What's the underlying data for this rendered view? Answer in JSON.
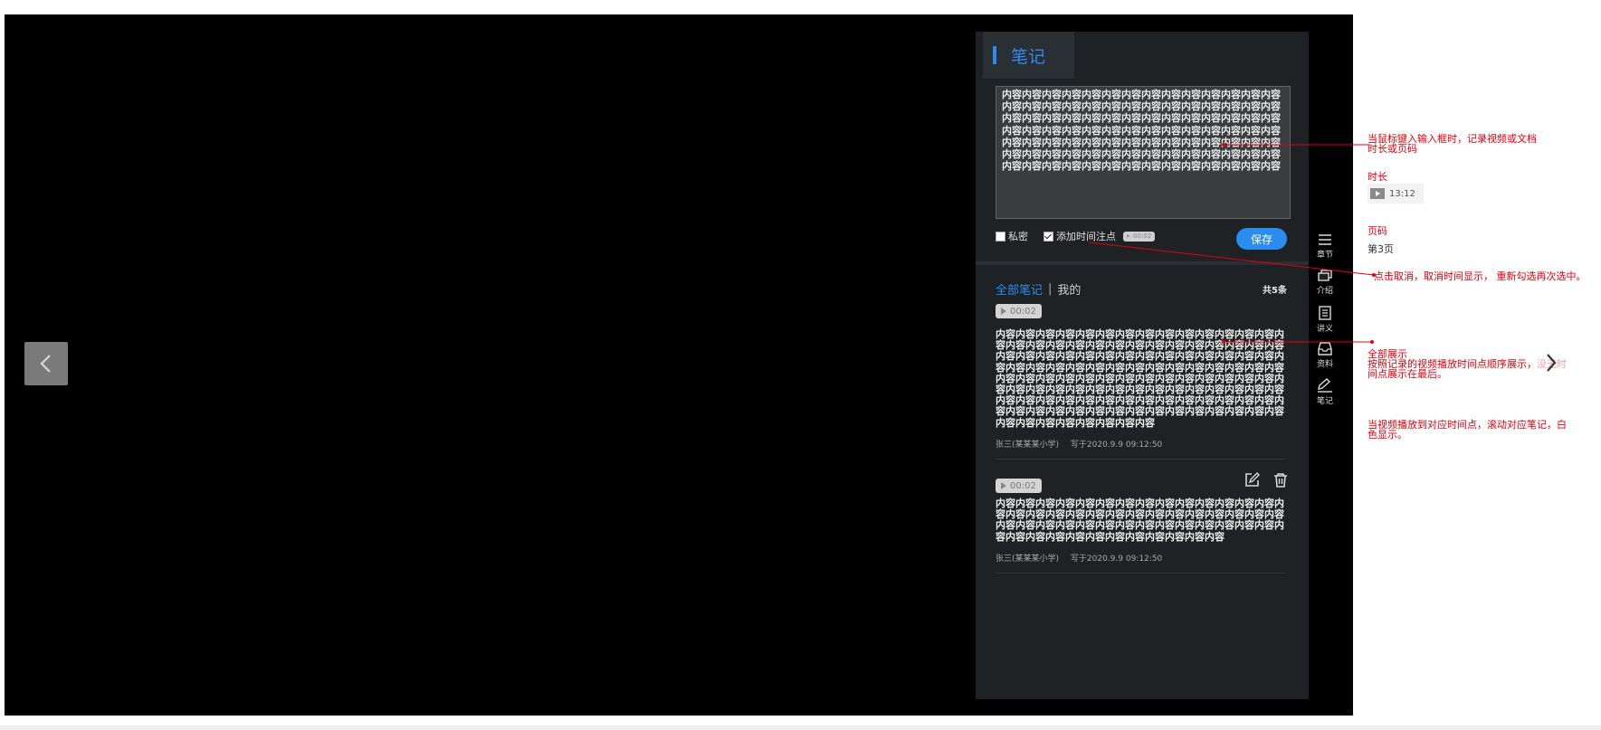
{
  "panel": {
    "title": "笔记",
    "editor_text": "内容内容内容内容内容内容内容内容内容内容内容内容内容内容内容内容内容内容内容内容内容内容内容内容内容内容内容内容内容内容内容内容内容内容内容内容内容内容内容内容内容内容内容内容内容内容内容内容内容内容内容内容内容内容内容内容内容内容内容内容内容内容内容内容内容内容内容内容内容内容内容内容内容内容内容内容内容内容内容内容内容内容内容内容内容内容内容内容内容内容内容内容内容内容内容内容内容内容",
    "private_label": "私密",
    "add_time_label": "添加时间注点",
    "time_chip": "00:02",
    "save_label": "保存"
  },
  "list": {
    "filter_all": "全部笔记",
    "filter_mine": "我的",
    "count": "共5条",
    "notes": [
      {
        "time": "00:02",
        "body": "内容内容内容内容内容内容内容内容内容内容内容内容内容内容内容内容内容内容内容内容内容内容内容内容内容内容内容内容内容内容内容内容内容内容内容内容内容内容内容内容内容内容内容内容内容内容内容内容内容内容内容内容内容内容内容内容内容内容内容内容内容内容内容内容内容内容内容内容内容内容内容内容内容内容内容内容内容内容内容内容内容内容内容内容内容内容内容内容内容内容内容内容内容内容内容内容内容内容内容内容内容内容内容内容内容内容内容内容内容内容内容内容内容内容内容内容内容内容内容内容内容内容内容内容",
        "author": "张三(某某某小学)",
        "date": "写于2020.9.9  09:12:50"
      },
      {
        "time": "00:02",
        "body": "内容内容内容内容内容内容内容内容内容内容内容内容内容内容内容内容内容内容内容内容内容内容内容内容内容内容内容内容内容内容内容内容内容内容内容内容内容内容内容内容内容内容内容内容内容内容内容内容内容内容内容内容内容内容内容",
        "author": "张三(某某某小学)",
        "date": "写于2020.9.9  09:12:50"
      }
    ]
  },
  "sidebar": {
    "items": [
      {
        "label": "章节",
        "icon": "list-icon"
      },
      {
        "label": "介绍",
        "icon": "intro-icon"
      },
      {
        "label": "讲义",
        "icon": "document-icon"
      },
      {
        "label": "资料",
        "icon": "inbox-icon"
      },
      {
        "label": "笔记",
        "icon": "pen-icon"
      }
    ]
  },
  "annotations": {
    "a1_line1": "当鼠标键入输入框时，记录视频或文档",
    "a1_line2": "时长或页码",
    "duration_label": "时长",
    "duration_value": "13:12",
    "page_label": "页码",
    "page_value": "第3页",
    "a2": "点击取消，取消时间显示，  重新勾选再次选中。",
    "a3_title": "全部展示",
    "a3_line1": "按照记录的视频播放时间点顺序展示，",
    "a3_line1_faded": "没无时",
    "a3_line2": "间点展示在最后。",
    "a4_line1": "当视频播放到对应时间点，滚动对应笔记，白",
    "a4_line2": "色显示。"
  },
  "colors": {
    "accent": "#2b8cf0",
    "annotation": "#e0000f",
    "panel": "#1f2224"
  }
}
